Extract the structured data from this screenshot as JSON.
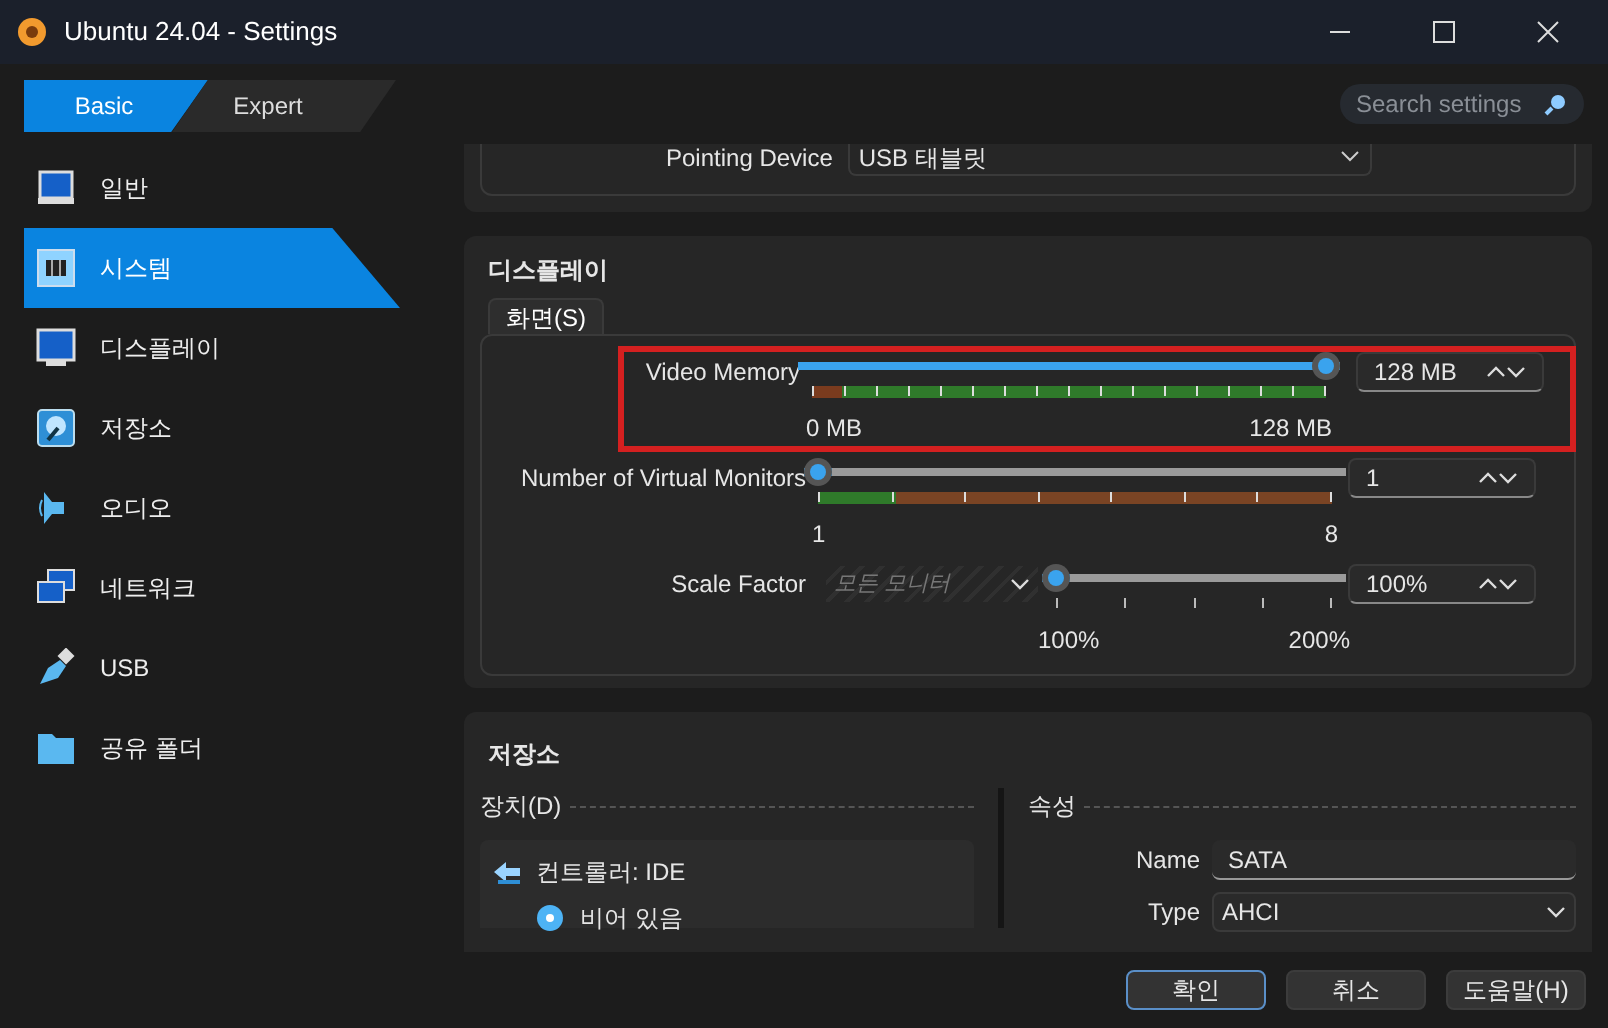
{
  "window": {
    "title": "Ubuntu 24.04 - Settings"
  },
  "mode_tabs": [
    {
      "label": "Basic",
      "selected": true
    },
    {
      "label": "Expert",
      "selected": false
    }
  ],
  "sidebar": {
    "items": [
      {
        "label": "일반",
        "kind": "general",
        "selected": false
      },
      {
        "label": "시스템",
        "kind": "system",
        "selected": true
      },
      {
        "label": "디스플레이",
        "kind": "display",
        "selected": false
      },
      {
        "label": "저장소",
        "kind": "storage",
        "selected": false
      },
      {
        "label": "오디오",
        "kind": "audio",
        "selected": false
      },
      {
        "label": "네트워크",
        "kind": "network",
        "selected": false
      },
      {
        "label": "USB",
        "kind": "usb",
        "selected": false
      },
      {
        "label": "공유 폴더",
        "kind": "folder",
        "selected": false
      }
    ]
  },
  "search": {
    "placeholder": "Search settings"
  },
  "pointing_device": {
    "label": "Pointing Device",
    "value": "USB 태블릿"
  },
  "display": {
    "title": "디스플레이",
    "tabs": [
      {
        "label": "화면(S)",
        "selected": true
      }
    ],
    "sliders": [
      {
        "label": "Video Memory",
        "kind": "band",
        "level": 1,
        "value": "128 MB",
        "min_label": "0 MB",
        "max_label": "128 MB",
        "highlighted": true
      },
      {
        "label": "Number of Virtual Monitors",
        "kind": "band",
        "level": 0,
        "value": "1",
        "min_label": "1",
        "max_label": "8",
        "highlighted": false
      },
      {
        "label": "Scale Factor",
        "kind": "ticks",
        "level": 0,
        "value": "100%",
        "min_label": "100%",
        "max_label": "200%",
        "highlighted": false,
        "monitor_select": {
          "placeholder": "모든 모니터",
          "disabled": true
        }
      }
    ]
  },
  "storage": {
    "title": "저장소",
    "devices": {
      "label": "장치(D)",
      "tree": [
        {
          "label": "컨트롤러: IDE",
          "kind": "controller",
          "children": [
            {
              "label": "비어 있음",
              "kind": "optical"
            }
          ]
        }
      ]
    },
    "attributes": {
      "label": "속성",
      "fields": [
        {
          "label": "Name",
          "value": "SATA",
          "kind": "text"
        },
        {
          "label": "Type",
          "value": "AHCI",
          "kind": "select"
        }
      ]
    }
  },
  "buttons": [
    {
      "label": "확인",
      "default": true
    },
    {
      "label": "취소",
      "default": false
    },
    {
      "label": "도움말(H)",
      "default": false
    }
  ]
}
